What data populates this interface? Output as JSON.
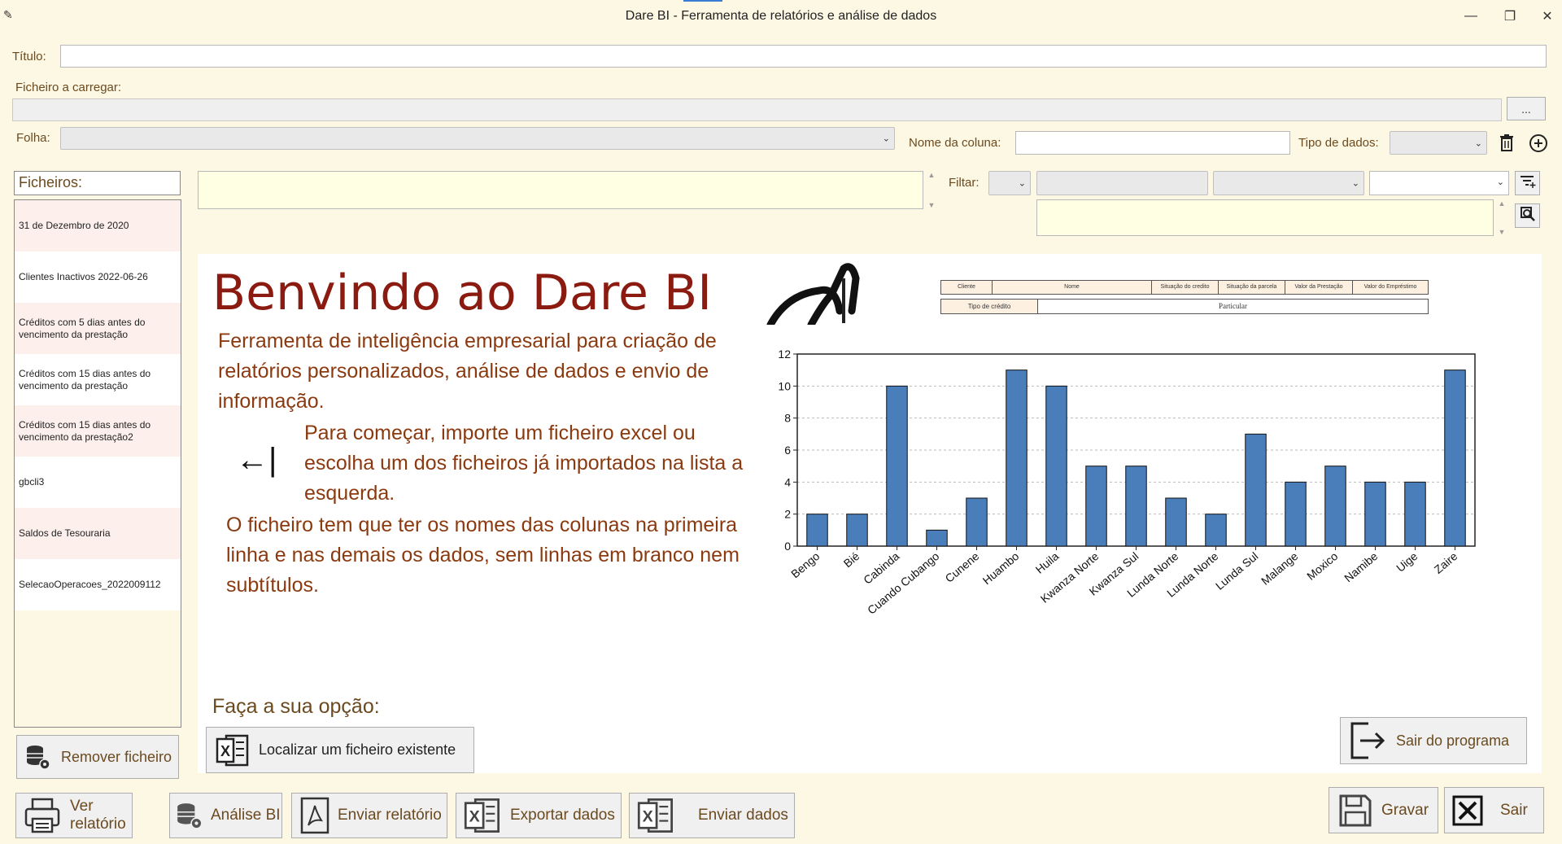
{
  "window": {
    "title": "Dare BI - Ferramenta de relatórios e análise de dados",
    "minimize": "—",
    "maximize": "❐",
    "close": "✕"
  },
  "form": {
    "titulo_label": "Título:",
    "titulo_value": "",
    "ficheiro_label": "Ficheiro a carregar:",
    "ficheiro_value": "",
    "browse_label": "...",
    "folha_label": "Folha:",
    "folha_value": "",
    "nome_coluna_label": "Nome da coluna:",
    "nome_coluna_value": "",
    "tipo_dados_label": "Tipo de dados:",
    "tipo_dados_value": "",
    "filtrar_label": "Filtar:"
  },
  "sidebar": {
    "header": "Ficheiros:",
    "items": [
      "31 de Dezembro de 2020",
      "Clientes Inactivos 2022-06-26",
      "Créditos com 5 dias antes do vencimento da prestação",
      "Créditos com 15 dias antes do vencimento da prestação",
      "Créditos com 15 dias antes do vencimento da prestação2",
      "gbcli3",
      "Saldos de Tesouraria",
      "SelecaoOperacoes_2022009112"
    ],
    "remove_button": "Remover ficheiro"
  },
  "welcome": {
    "heading": "Benvindo ao Dare BI",
    "intro": "Ferramenta de inteligência empresarial para criação de relatórios personalizados, análise de dados e envio de informação.",
    "arrow": "←|",
    "start_text": "Para começar, importe um ficheiro excel ou escolha um dos ficheiros já importados na lista a esquerda.",
    "note": "O ficheiro tem que ter os nomes das colunas na primeira linha e nas demais os dados, sem linhas em branco nem subtítulos.",
    "option_label": "Faça a sua opção:",
    "locate_button": "Localizar um ficheiro existente",
    "exit_program_button": "Sair do programa"
  },
  "preview_table": {
    "headers": [
      "Cliente",
      "Nome",
      "Situação do credito",
      "Situação da parcela",
      "Valor da Prestação",
      "Valor do Empréstimo"
    ],
    "row2_label": "Tipo de crédito",
    "row2_value": "Particular"
  },
  "chart_data": {
    "type": "bar",
    "categories": [
      "Bengo",
      "Bié",
      "Cabinda",
      "Cuando Cubango",
      "Cunene",
      "Huambo",
      "Huila",
      "Kwanza Norte",
      "Kwanza Sul",
      "Lunda Norte",
      "Lunda Norte",
      "Lunda Sul",
      "Malange",
      "Moxico",
      "Namibe",
      "Uige",
      "Zaire"
    ],
    "values": [
      2,
      2,
      10,
      1,
      3,
      11,
      10,
      5,
      5,
      3,
      2,
      7,
      4,
      5,
      4,
      4,
      11
    ],
    "ylim": [
      0,
      12
    ],
    "yticks": [
      0,
      2,
      4,
      6,
      8,
      10,
      12
    ],
    "grid": true,
    "bar_color": "#4a7ebb"
  },
  "bottom": {
    "ver_relatorio": "Ver relatório",
    "analise_bi": "Análise BI",
    "enviar_relatorio": "Enviar relatório",
    "exportar_dados": "Exportar dados",
    "enviar_dados": "Enviar dados",
    "gravar": "Gravar",
    "sair": "Sair"
  }
}
